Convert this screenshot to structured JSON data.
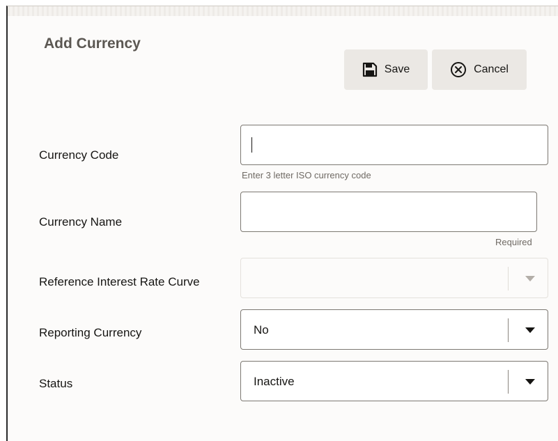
{
  "page": {
    "title": "Add Currency"
  },
  "toolbar": {
    "save_label": "Save",
    "cancel_label": "Cancel"
  },
  "form": {
    "currency_code": {
      "label": "Currency Code",
      "value": "",
      "help": "Enter 3 letter ISO currency code"
    },
    "currency_name": {
      "label": "Currency Name",
      "value": "",
      "help": "Required"
    },
    "reference_interest_rate_curve": {
      "label": "Reference Interest Rate Curve",
      "value": "",
      "disabled": true
    },
    "reporting_currency": {
      "label": "Reporting Currency",
      "value": "No"
    },
    "status": {
      "label": "Status",
      "value": "Inactive"
    }
  },
  "icons": {
    "save": "save-disk-icon",
    "cancel": "circle-x-icon",
    "dropdown": "caret-down-icon"
  },
  "colors": {
    "background": "#fcfbfa",
    "button": "#ebe8e4",
    "border": "#7c7872",
    "text": "#161513",
    "muted": "#6f6a64"
  }
}
